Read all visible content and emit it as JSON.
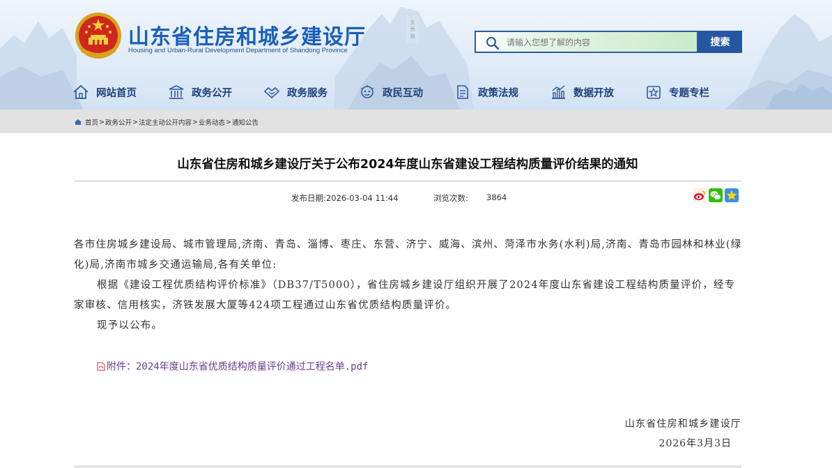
{
  "header": {
    "site_title": "山东省住房和城乡建设厅",
    "site_subtitle": "Housing and Urban-Rural Development Department of Shandong Province",
    "colors": {
      "title_blue": "#1b5fb7",
      "nav_blue": "#1f3f7a",
      "search_button": "#2556a3"
    }
  },
  "search": {
    "placeholder": "请输入您想了解的内容",
    "button_label": "搜索"
  },
  "nav": {
    "items": [
      {
        "label": "网站首页",
        "icon": "home-icon"
      },
      {
        "label": "政务公开",
        "icon": "government-building-icon"
      },
      {
        "label": "政务服务",
        "icon": "handshake-icon"
      },
      {
        "label": "政民互动",
        "icon": "interaction-icon"
      },
      {
        "label": "政策法规",
        "icon": "document-icon"
      },
      {
        "label": "数据开放",
        "icon": "bar-chart-icon"
      },
      {
        "label": "专题专栏",
        "icon": "star-icon"
      }
    ]
  },
  "breadcrumb": {
    "items": [
      "首页",
      "政务公开",
      "法定主动公开内容",
      "业务动态",
      "通知公告"
    ],
    "separator": ">"
  },
  "article": {
    "title": "山东省住房和城乡建设厅关于公布2024年度山东省建设工程结构质量评价结果的通知",
    "publish_label": "发布日期:",
    "publish_date": "2026-03-04 11:44",
    "views_label": "浏览次数:",
    "views": "3864",
    "share_icons": [
      "weibo-icon",
      "wechat-icon",
      "favorite-star-icon"
    ],
    "paragraphs": [
      "各市住房城乡建设局、城市管理局,济南、青岛、淄博、枣庄、东营、济宁、威海、滨州、菏泽市水务(水利)局,济南、青岛市园林和林业(绿化)局,济南市城乡交通运输局,各有关单位:",
      "根据《建设工程优质结构评价标准》（DB37/T5000），省住房城乡建设厅组织开展了2024年度山东省建设工程结构质量评价，经专家审核、信用核实，济铁发展大厦等424项工程通过山东省优质结构质量评价。",
      "现予以公布。"
    ],
    "attachment": "附件：2024年度山东省优质结构质量评价通过工程名单.pdf",
    "signature_org": "山东省住房和城乡建设厅",
    "signature_date": "2026年3月3日"
  }
}
